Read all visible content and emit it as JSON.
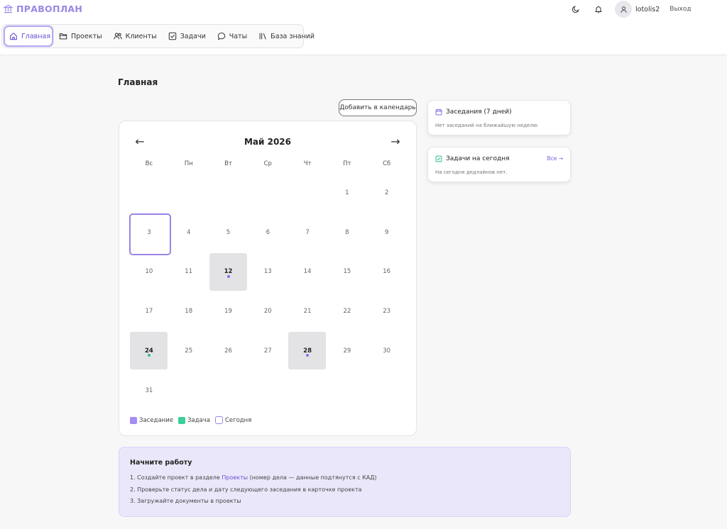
{
  "brand": {
    "name": "ПРАВОПЛАН",
    "icon": "bank-icon",
    "color": "#9a86e6"
  },
  "nav": {
    "tabs": [
      {
        "label": "Главная",
        "icon": "home-icon",
        "active": true
      },
      {
        "label": "Проекты",
        "icon": "folder-icon"
      },
      {
        "label": "Клиенты",
        "icon": "users-icon"
      },
      {
        "label": "Задачи",
        "icon": "checkbox-icon"
      },
      {
        "label": "Чаты",
        "icon": "chat-icon"
      },
      {
        "label": "База знаний",
        "icon": "library-icon"
      }
    ]
  },
  "user": {
    "name": "lotolis2",
    "logout": "Выход"
  },
  "page": {
    "title": "Главная"
  },
  "calendar": {
    "add_button": "Добавить в календарь",
    "month_label": "Май 2026",
    "prev": "←",
    "next": "→",
    "weekdays": [
      "Вс",
      "Пн",
      "Вт",
      "Ср",
      "Чт",
      "Пт",
      "Сб"
    ],
    "days": [
      "",
      "",
      "",
      "",
      "",
      "1",
      "2",
      "3",
      "4",
      "5",
      "6",
      "7",
      "8",
      "9",
      "10",
      "11",
      "12",
      "13",
      "14",
      "15",
      "16",
      "17",
      "18",
      "19",
      "20",
      "21",
      "22",
      "23",
      "24",
      "25",
      "26",
      "27",
      "28",
      "29",
      "30",
      "31",
      "",
      "",
      "",
      "",
      "",
      ""
    ],
    "today": "3",
    "events": {
      "12": "hearing",
      "24": "task",
      "28": "hearing"
    },
    "legend": {
      "hearing": "Заседание",
      "task": "Задача",
      "today": "Сегодня"
    }
  },
  "colors": {
    "hearing": "#a48cf5",
    "task": "#3ccf98",
    "today_border": "#9b84e6",
    "accent": "#6a4fd0"
  },
  "hearings_card": {
    "title": "Заседания (7 дней)",
    "icon": "calendar-icon",
    "text": "Нет заседаний на ближайшую неделю."
  },
  "tasks_card": {
    "title": "Задачи на сегодня",
    "icon": "check-square-icon",
    "link": "Все →",
    "text": "На сегодня дедлайнов нет."
  },
  "getting_started": {
    "title": "Начните работу",
    "step1_pre": "1. Создайте проект в разделе ",
    "step1_link": "Проекты",
    "step1_post": " (номер дела — данные подтянутся с КАД)",
    "step2": "2. Проверьте статус дела и дату следующего заседания в карточке проекта",
    "step3": "3. Загружайте документы в проекты"
  }
}
